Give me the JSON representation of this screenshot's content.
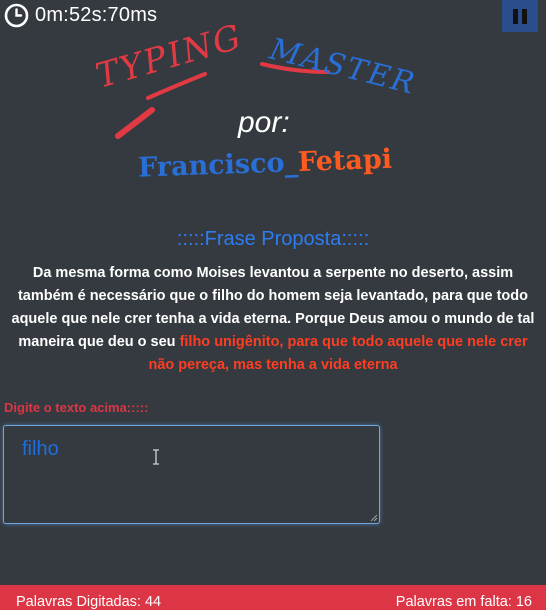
{
  "timer": {
    "icon": "clock-icon",
    "text": "0m:52s:70ms"
  },
  "pause": {
    "icon": "pause-icon",
    "color": "#2b4d8c"
  },
  "logo": {
    "title_word1": "TYPING",
    "title_word2": "MASTER",
    "by": "por:",
    "author_first": "Francisco_",
    "author_last": "Fetapi",
    "colors": {
      "title_red": "#e23a44",
      "title_blue": "#2a6fd6",
      "author_blue": "#2a6fd6",
      "author_orange": "#ff5a1f"
    }
  },
  "phrase": {
    "title": ":::::Frase Proposta:::::",
    "typed": "Da mesma forma como Moises levantou a serpente no deserto, assim também é necessário que o filho do homem seja levantado, para que todo aquele que nele crer tenha a vida eterna. Porque Deus amou o mundo de tal maneira que deu o seu ",
    "remaining": "filho unigênito, para que todo aquele que nele crer não pereça, mas tenha a vida eterna"
  },
  "input": {
    "label": "Digite o texto acima:::::",
    "value": "filho"
  },
  "footer": {
    "typed_words": "Palavras Digitadas: 44",
    "remaining_words": "Palavras em falta: 16",
    "color": "#dc3545"
  }
}
